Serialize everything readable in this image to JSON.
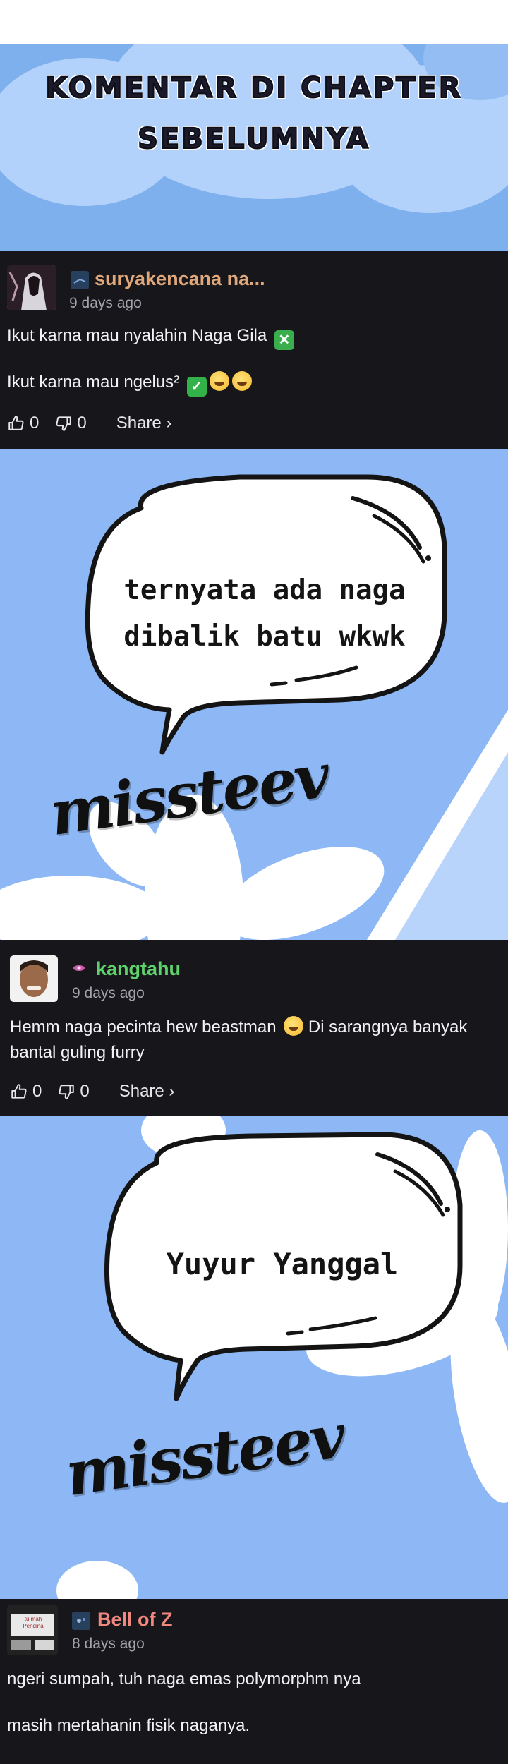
{
  "header": {
    "title_line1": "KOMENTAR DI CHAPTER",
    "title_line2": "SEBELUMNYA"
  },
  "comments": [
    {
      "username": "suryakencana na...",
      "time": "9 days ago",
      "lines": [
        "Ikut karna mau nyalahin Naga Gila",
        "Ikut karna mau ngelus²"
      ],
      "likes": "0",
      "dislikes": "0",
      "share_label": "Share ›",
      "username_color": "#e0a77a"
    },
    {
      "username": "kangtahu",
      "time": "9 days ago",
      "lines": [
        "Hemm naga pecinta hew beastman",
        "Di sarangnya banyak",
        "bantal guling furry"
      ],
      "likes": "0",
      "dislikes": "0",
      "share_label": "Share ›",
      "username_color": "#5fd36b"
    },
    {
      "username": "Bell of Z",
      "time": "8 days ago",
      "lines": [
        "ngeri sumpah, tuh naga emas polymorphm nya",
        "masih mertahanin fisik naganya."
      ],
      "avatar_text": "tu mah Pendina",
      "username_color": "#f08880"
    }
  ],
  "art_panels": [
    {
      "bubble_line1": "ternyata ada naga",
      "bubble_line2": "dibalik batu wkwk",
      "signature": "missteev"
    },
    {
      "bubble_line1": "Yuyur Yanggal",
      "signature": "missteev"
    }
  ],
  "icons": {
    "like": "thumbs-up-icon",
    "dislike": "thumbs-down-icon",
    "badge": "user-badge-icon",
    "check": "check-emoji-icon",
    "cross": "cross-emoji-icon",
    "grin": "grin-emoji-icon"
  },
  "colors": {
    "dark_bg": "#17171b",
    "panel_blue": "#8db8f5",
    "muted_text": "#a4a4ac"
  }
}
